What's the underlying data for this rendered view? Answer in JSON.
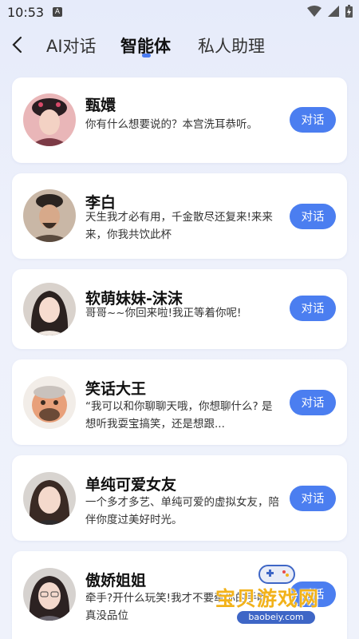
{
  "status_bar": {
    "time": "10:53",
    "notification_glyph": "A"
  },
  "tabs": [
    {
      "label": "AI对话"
    },
    {
      "label": "智能体",
      "active": true
    },
    {
      "label": "私人助理"
    }
  ],
  "agents": [
    {
      "name": "甄嬛",
      "description": "你有什么想要说的？本宫洗耳恭听。",
      "button": "对话",
      "avatar": "avatar-zhenhuan"
    },
    {
      "name": "李白",
      "description": "天生我才必有用，千金散尽还复来!来来来，你我共饮此杯",
      "button": "对话",
      "avatar": "avatar-libai"
    },
    {
      "name": "软萌妹妹-沫沫",
      "description": "哥哥~~你回来啦!我正等着你呢!",
      "button": "对话",
      "avatar": "avatar-momo"
    },
    {
      "name": "笑话大王",
      "description": "“我可以和你聊聊天哦，你想聊什么? 是想听我耍宝搞笑，还是想跟...",
      "button": "对话",
      "avatar": "avatar-joker"
    },
    {
      "name": "单纯可爱女友",
      "description": "一个多才多艺、单纯可爱的虚拟女友，陪伴你度过美好时光。",
      "button": "对话",
      "avatar": "avatar-girlfriend"
    },
    {
      "name": "傲娇姐姐",
      "description": "牵手?开什么玩笑!我才不要牵你的手呢,真没品位",
      "button": "对话",
      "avatar": "avatar-sister"
    }
  ],
  "watermark": {
    "text": "宝贝游戏网",
    "url": "baobeiy.com"
  },
  "colors": {
    "accent": "#4b7ef0",
    "background": "#e9edfa"
  }
}
